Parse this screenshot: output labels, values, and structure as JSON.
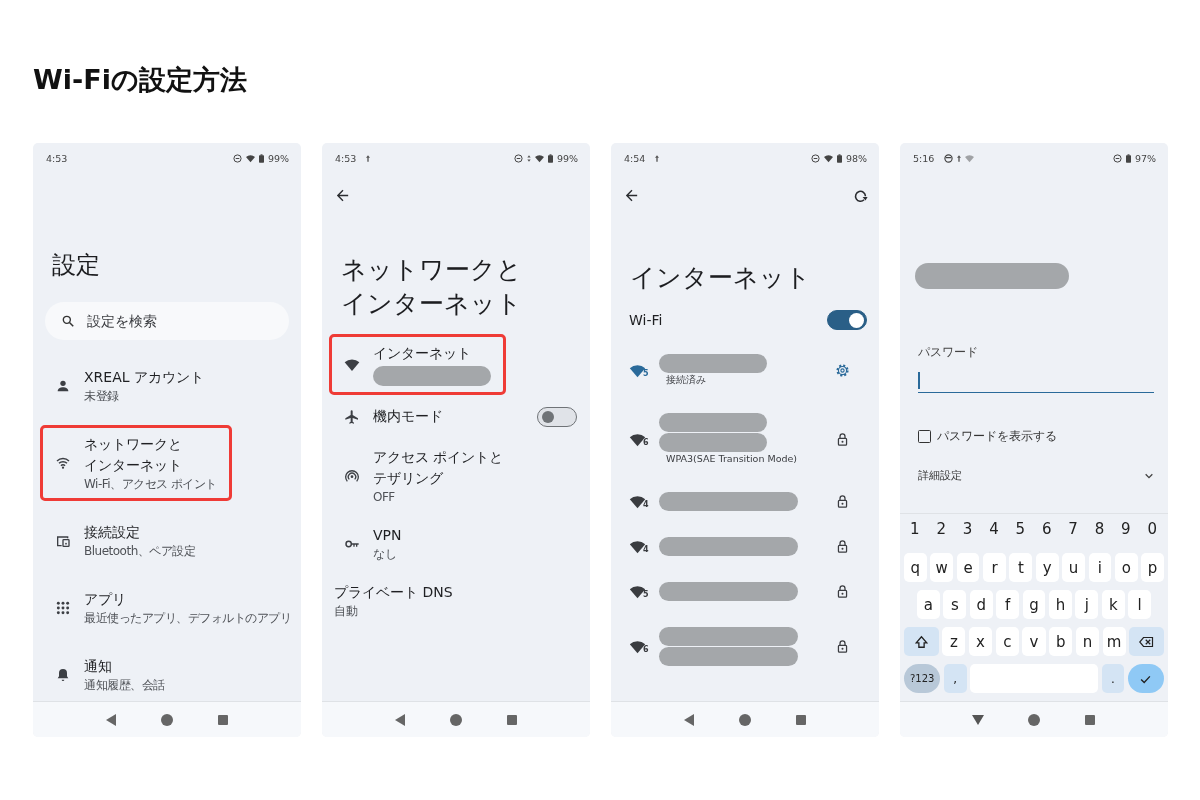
{
  "title": "Wi-Fiの設定方法",
  "phones": [
    {
      "kind": "settings",
      "status": {
        "time": "4:53",
        "battery": "99%"
      },
      "heading": [
        "設定"
      ],
      "search": {
        "placeholder": "設定を検索"
      },
      "items": [
        {
          "title": [
            "XREAL アカウント"
          ],
          "subtitle": "未登録",
          "highlighted": false
        },
        {
          "title": [
            "ネットワークと",
            "インターネット"
          ],
          "subtitle": "Wi-Fi、アクセス ポイント",
          "highlighted": true
        },
        {
          "title": [
            "接続設定"
          ],
          "subtitle": "Bluetooth、ペア設定",
          "highlighted": false
        },
        {
          "title": [
            "アプリ"
          ],
          "subtitle": "最近使ったアプリ、デフォルトのアプリ",
          "highlighted": false
        },
        {
          "title": [
            "通知"
          ],
          "subtitle": "通知履歴、会話",
          "highlighted": false
        }
      ]
    },
    {
      "kind": "menu",
      "status": {
        "time": "4:53",
        "battery": "99%"
      },
      "heading": [
        "ネットワークと",
        "インターネット"
      ],
      "items": [
        {
          "title": [
            "インターネット"
          ],
          "hidden_subtitle": true,
          "highlighted": true
        },
        {
          "title": [
            "機内モード"
          ],
          "toggle": {
            "on": false
          },
          "highlighted": false
        },
        {
          "title": [
            "アクセス ポイントと",
            "テザリング"
          ],
          "subtitle": "OFF",
          "highlighted": false
        },
        {
          "title": [
            "VPN"
          ],
          "subtitle": "なし",
          "highlighted": false
        },
        {
          "title": [
            "プライベート DNS"
          ],
          "subtitle": "自動",
          "highlighted": false
        }
      ]
    },
    {
      "kind": "wifi_list",
      "status": {
        "time": "4:54",
        "battery": "98%"
      },
      "heading": [
        "インターネット"
      ],
      "wifi": {
        "label": "Wi-Fi",
        "on": true
      },
      "networks": [
        {
          "band": "5",
          "connected": true,
          "double": false,
          "wide": false,
          "subtitle": "接続済み"
        },
        {
          "band": "6",
          "connected": false,
          "double": true,
          "wide": false,
          "subtitle": "WPA3(SAE Transition Mode)"
        },
        {
          "band": "4",
          "connected": false,
          "double": false,
          "wide": true
        },
        {
          "band": "4",
          "connected": false,
          "double": false,
          "wide": true
        },
        {
          "band": "5",
          "connected": false,
          "double": false,
          "wide": true
        },
        {
          "band": "6",
          "connected": false,
          "double": true,
          "wide": true
        }
      ]
    },
    {
      "kind": "password",
      "status": {
        "time": "5:16",
        "battery": "97%"
      },
      "password": {
        "label": "パスワード",
        "focused": true
      },
      "show_password": {
        "label": "パスワードを表示する",
        "checked": false
      },
      "advanced": {
        "label": "詳細設定",
        "expanded": false
      },
      "keyboard": {
        "number_row": [
          "1",
          "2",
          "3",
          "4",
          "5",
          "6",
          "7",
          "8",
          "9",
          "0"
        ],
        "rows": [
          [
            "q",
            "w",
            "e",
            "r",
            "t",
            "y",
            "u",
            "i",
            "o",
            "p"
          ],
          [
            "a",
            "s",
            "d",
            "f",
            "g",
            "h",
            "j",
            "k",
            "l"
          ],
          [
            "z",
            "x",
            "c",
            "v",
            "b",
            "n",
            "m"
          ]
        ],
        "symbols_key": "?123",
        "comma": ",",
        "period": "."
      }
    }
  ]
}
